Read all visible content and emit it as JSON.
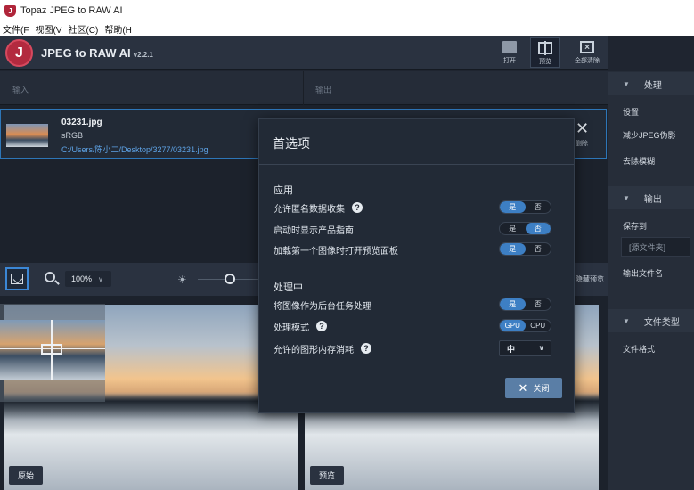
{
  "window": {
    "title": "Topaz JPEG to RAW AI"
  },
  "menubar": {
    "items": [
      "文件(F",
      "视图(V",
      "社区(C)",
      "帮助(H"
    ]
  },
  "header": {
    "app_name": "JPEG to RAW AI",
    "version": "v2.2.1",
    "toolbar": {
      "open_label": "打开",
      "preview_label": "预览",
      "clear_all_label": "全部清除"
    }
  },
  "filelist": {
    "columns": {
      "input": "输入",
      "output": "输出"
    },
    "files": [
      {
        "name": "03231.jpg",
        "color_space": "sRGB",
        "path": "C:/Users/陈小二/Desktop/3277/03231.jpg",
        "delete_label": "删除"
      }
    ]
  },
  "preview_toolbar": {
    "zoom": "100%",
    "hide_preview_label": "隐藏预览"
  },
  "preview": {
    "original_label": "原始",
    "preview_label": "预览"
  },
  "right_panel": {
    "processing": {
      "title": "处理",
      "items": [
        "设置",
        "减少JPEG伪影",
        "去除模糊"
      ]
    },
    "output": {
      "title": "输出",
      "save_to_label": "保存到",
      "source_folder": "[源文件夹]",
      "output_filename_label": "输出文件名"
    },
    "filetype": {
      "title": "文件类型",
      "format_label": "文件格式"
    }
  },
  "dialog": {
    "title": "首选项",
    "section_app": "应用",
    "allow_anon": "允许匿名数据收集",
    "show_guide": "启动时显示产品指南",
    "open_preview": "加载第一个图像时打开预览面板",
    "section_processing": "处理中",
    "bg_task": "将图像作为后台任务处理",
    "proc_mode": "处理模式",
    "mem_usage": "允许的图形内存消耗",
    "yes": "是",
    "no": "否",
    "gpu": "GPU",
    "cpu": "CPU",
    "mem_value": "中",
    "close_label": "关闭",
    "toggles": {
      "allow_anon": "是",
      "show_guide": "否",
      "open_preview": "是",
      "bg_task": "是",
      "proc_mode": "GPU"
    }
  },
  "colors": {
    "accent": "#3d7fc4",
    "brand": "#b32a3f",
    "selection_border": "#2d76b8"
  },
  "icons": [
    "app-icon",
    "folder-icon",
    "preview-icon",
    "clear-icon",
    "close-icon",
    "zoom-icon",
    "fit-icon",
    "brightness-icon",
    "help-icon",
    "chevron-down-icon"
  ]
}
